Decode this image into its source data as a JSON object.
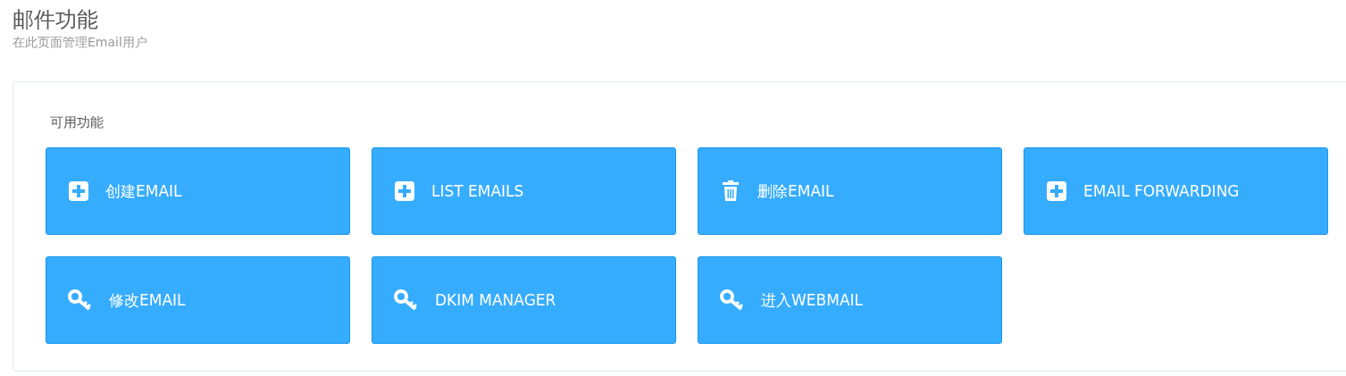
{
  "page": {
    "title": "邮件功能",
    "subtitle": "在此页面管理Email用户"
  },
  "panel": {
    "heading": "可用功能",
    "actions": [
      {
        "label": "创建EMAIL",
        "kind": "add"
      },
      {
        "label": "LIST EMAILS",
        "kind": "add"
      },
      {
        "label": "删除EMAIL",
        "kind": "delete"
      },
      {
        "label": "EMAIL FORWARDING",
        "kind": "add"
      },
      {
        "label": "修改EMAIL",
        "kind": "manage"
      },
      {
        "label": "DKIM MANAGER",
        "kind": "manage"
      },
      {
        "label": "进入WEBMAIL",
        "kind": "manage"
      }
    ]
  }
}
